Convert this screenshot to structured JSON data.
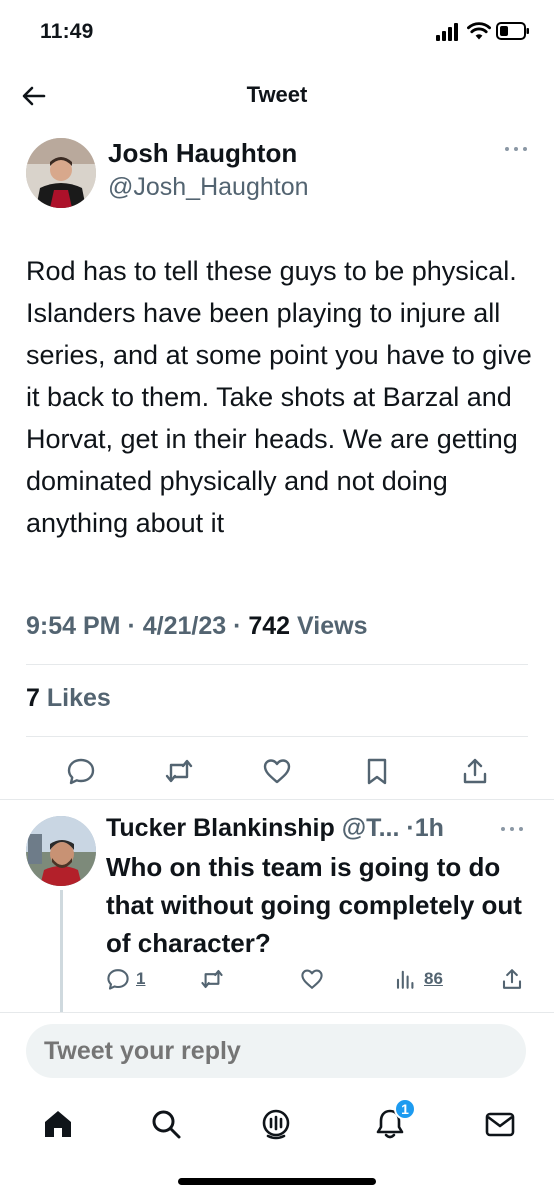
{
  "status_bar": {
    "time": "11:49"
  },
  "nav": {
    "title": "Tweet"
  },
  "tweet": {
    "author_name": "Josh Haughton",
    "author_handle": "@Josh_Haughton",
    "text": "Rod has to tell these guys to be physical. Islanders have been playing to injure all series, and at some point you have to give it back to them. Take shots at Barzal and Horvat, get in their heads. We are getting dominated physically and not doing anything about it",
    "time": "9:54 PM",
    "date": "4/21/23",
    "views_count": "742",
    "views_label": "Views",
    "likes_count": "7",
    "likes_label": "Likes"
  },
  "reply": {
    "author_name": "Tucker Blankinship",
    "handle_trunc": "@T...",
    "age": "1h",
    "text": "Who on this team is going to do that without going completely out of character?",
    "reply_count": "1",
    "views_count": "86"
  },
  "composer": {
    "placeholder": "Tweet your reply"
  },
  "notifications": {
    "badge": "1"
  },
  "colors": {
    "accent": "#1d9bf0",
    "secondary_text": "#536471",
    "primary_text": "#0f1419"
  }
}
